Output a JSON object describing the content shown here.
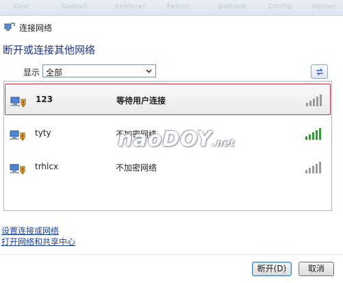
{
  "window": {
    "title": "连接网络"
  },
  "top_strip": [
    "Cnic",
    "Gomail",
    "Explorer",
    "Fetion",
    "Outlook",
    "Config",
    "Option"
  ],
  "heading": "断开或连接其他网络",
  "filter": {
    "label": "显示",
    "selected": "全部"
  },
  "networks": [
    {
      "name": "123",
      "status": "等待用户连接",
      "signal_bars": 5,
      "signal_color": "#9a9a9a",
      "selected": true
    },
    {
      "name": "tyty",
      "status": "不加密网络",
      "signal_bars": 5,
      "signal_color": "#2f9e2f",
      "selected": false
    },
    {
      "name": "trhlcx",
      "status": "不加密网络",
      "signal_bars": 5,
      "signal_color": "#9a9a9a",
      "selected": false
    }
  ],
  "watermark": {
    "main": "naoDOY",
    "suffix": ".net"
  },
  "links": {
    "setup": "设置连接或网络",
    "network_center": "打开网络和共享中心"
  },
  "buttons": {
    "disconnect": "断开(D)",
    "cancel": "取消"
  },
  "colors": {
    "heading": "#1e3287",
    "link": "#1a3f9e",
    "selection_border": "#c8303a"
  }
}
